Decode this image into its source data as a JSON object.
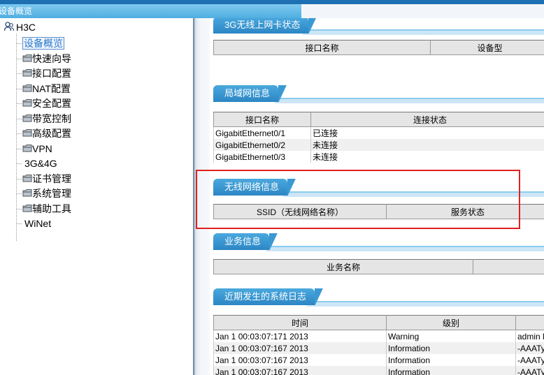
{
  "window": {
    "title": "设备概览"
  },
  "sidebar": {
    "root": "H3C",
    "items": [
      {
        "label": "设备概览",
        "selected": true,
        "icon": "none"
      },
      {
        "label": "快速向导",
        "icon": "folder-icon"
      },
      {
        "label": "接口配置",
        "icon": "folder-icon"
      },
      {
        "label": "NAT配置",
        "icon": "folder-icon"
      },
      {
        "label": "安全配置",
        "icon": "folder-icon"
      },
      {
        "label": "带宽控制",
        "icon": "folder-icon"
      },
      {
        "label": "高级配置",
        "icon": "folder-icon"
      },
      {
        "label": "VPN",
        "icon": "folder-icon"
      },
      {
        "label": "3G&4G",
        "icon": "none"
      },
      {
        "label": "证书管理",
        "icon": "folder-icon"
      },
      {
        "label": "系统管理",
        "icon": "folder-icon"
      },
      {
        "label": "辅助工具",
        "icon": "folder-icon"
      },
      {
        "label": "WiNet",
        "icon": "none"
      }
    ]
  },
  "sections": {
    "wan3g": {
      "title": "3G无线上网卡状态",
      "headers": [
        "接口名称",
        "设备型"
      ]
    },
    "lan": {
      "title": "局域网信息",
      "headers": [
        "接口名称",
        "连接状态"
      ],
      "rows": [
        [
          "GigabitEthernet0/1",
          "已连接"
        ],
        [
          "GigabitEthernet0/2",
          "未连接"
        ],
        [
          "GigabitEthernet0/3",
          "未连接"
        ]
      ]
    },
    "wireless": {
      "title": "无线网络信息",
      "headers": [
        "SSID（无线网络名称）",
        "服务状态"
      ]
    },
    "service": {
      "title": "业务信息",
      "headers": [
        "业务名称",
        ""
      ]
    },
    "syslog": {
      "title": "近期发生的系统日志",
      "headers": [
        "时间",
        "级别",
        ""
      ],
      "rows": [
        [
          "Jan 1 00:03:07:171 2013",
          "Warning",
          "admin l"
        ],
        [
          "Jan 1 00:03:07:167 2013",
          "Information",
          "-AAATyp"
        ],
        [
          "Jan 1 00:03:07:167 2013",
          "Information",
          "-AAATyp"
        ],
        [
          "Jan 1 00:03:07:167 2013",
          "Information",
          "-AAATyp"
        ]
      ]
    }
  },
  "colors": {
    "accent": "#2c86c4",
    "highlight_box": "#e02020",
    "title_bar": "#4faee0"
  }
}
